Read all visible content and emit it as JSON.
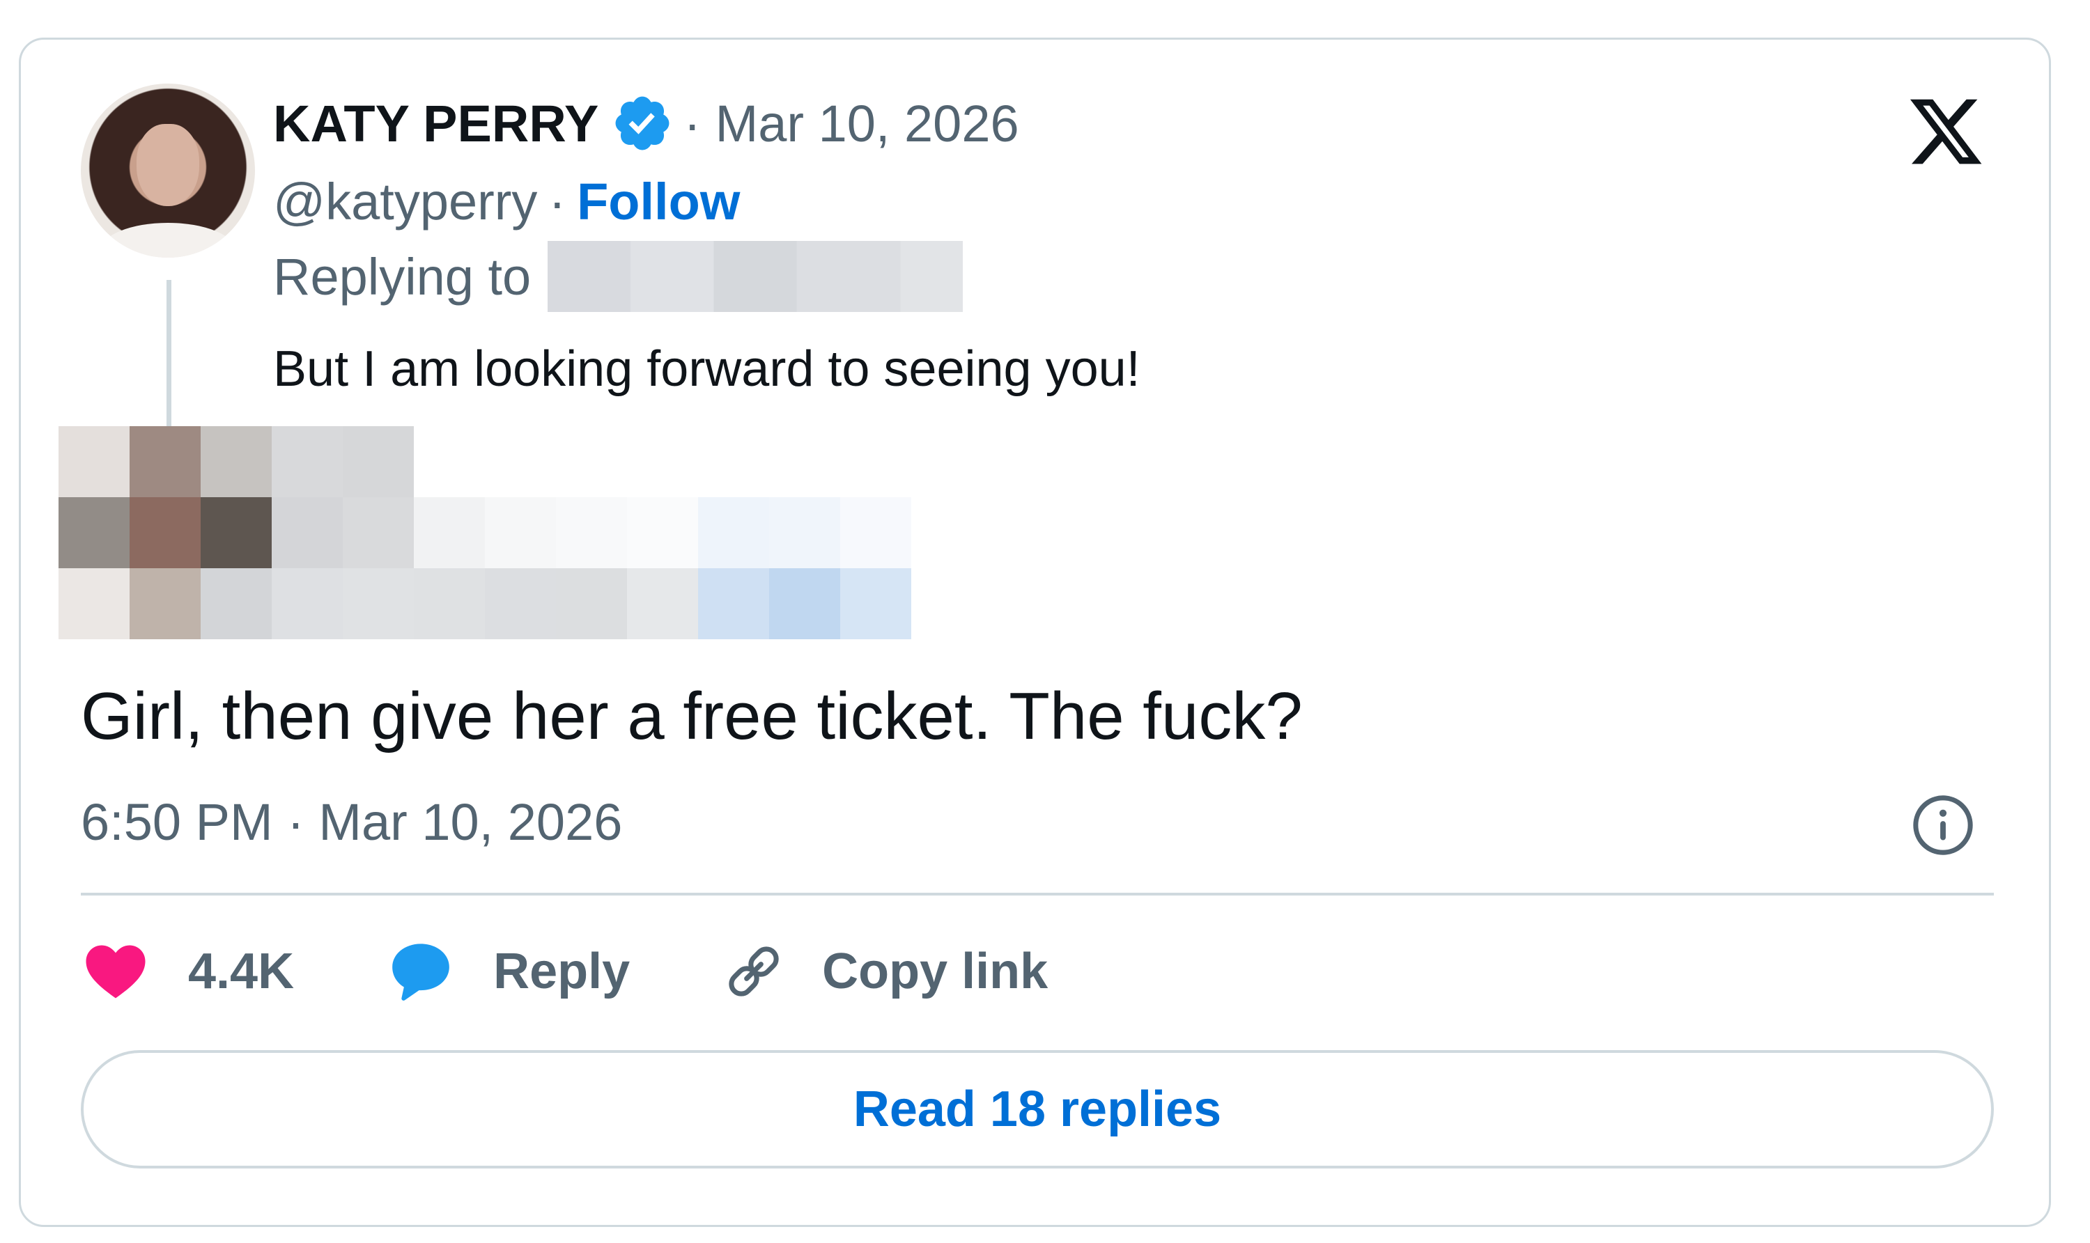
{
  "tweet": {
    "author_name": "KATY PERRY",
    "date_meta": "· Mar 10, 2026",
    "handle": "@katyperry",
    "handle_separator": "·",
    "follow_label": "Follow",
    "replying_to_label": "Replying to",
    "parent_text": "But I am looking forward to seeing you!",
    "text": "Girl, then give her a free ticket. The fuck?",
    "timestamp": "6:50 PM · Mar 10, 2026"
  },
  "icons": {
    "logo": "x-logo-icon",
    "verified": "verified-badge-icon",
    "info": "info-icon",
    "like": "heart-icon",
    "reply": "reply-bubble-icon",
    "copy": "link-icon"
  },
  "actions": {
    "like_count": "4.4K",
    "reply_label": "Reply",
    "copy_label": "Copy link"
  },
  "read_replies_label": "Read 18 replies",
  "colors": {
    "accent": "#006fd6",
    "heart": "#f91880",
    "reply_icon": "#1d9bf0",
    "verified": "#1d9bf0",
    "secondary_text": "#536471",
    "border": "#cfd9de"
  }
}
